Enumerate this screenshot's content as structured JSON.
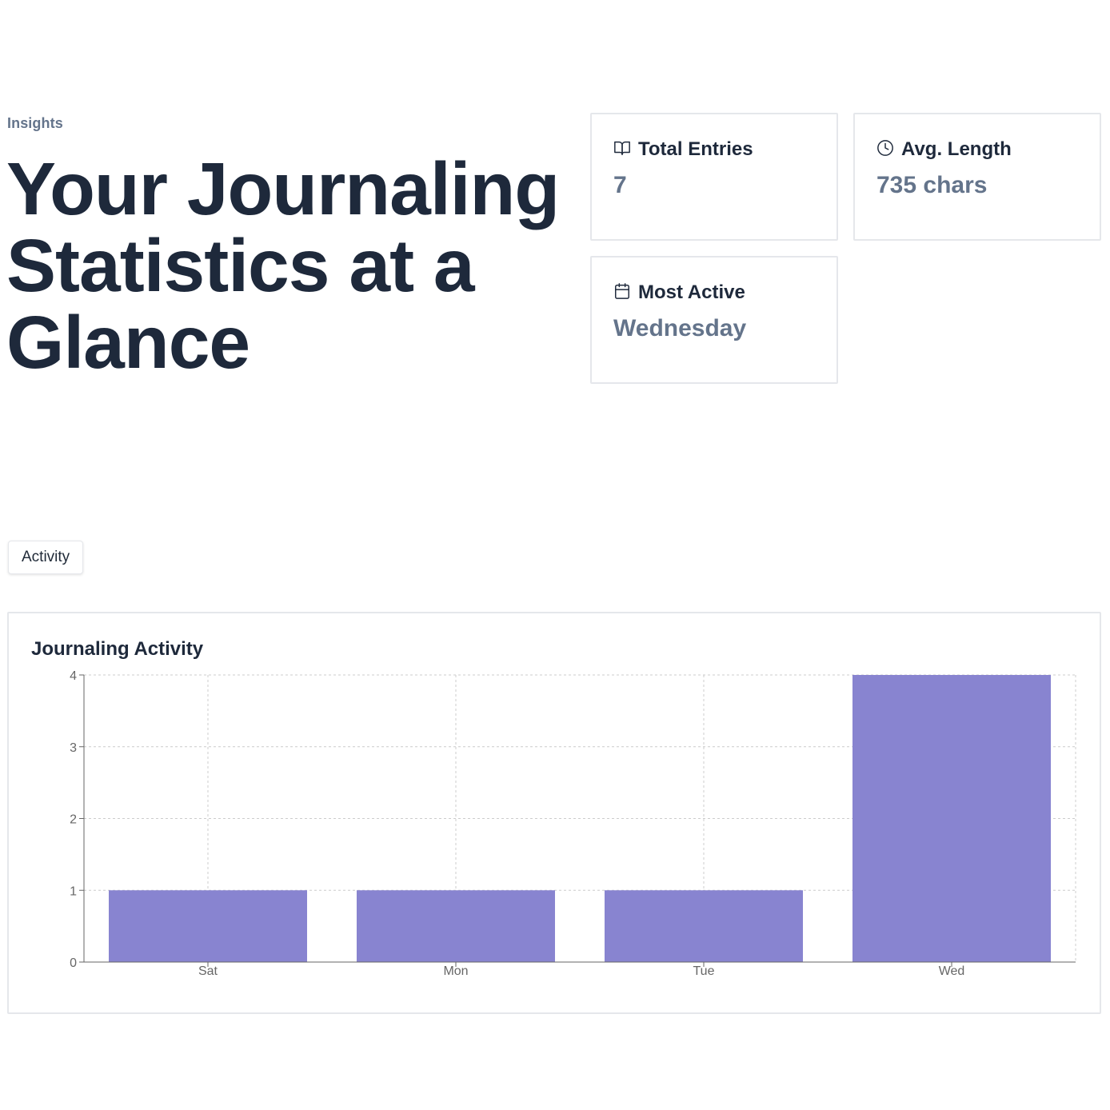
{
  "header": {
    "eyebrow": "Insights",
    "title": "Your Journaling Statistics at a Glance"
  },
  "stats": {
    "total": {
      "label": "Total Entries",
      "value": "7",
      "icon": "book-open-icon"
    },
    "avg": {
      "label": "Avg. Length",
      "value": "735 chars",
      "icon": "clock-icon"
    },
    "active": {
      "label": "Most Active",
      "value": "Wednesday",
      "icon": "calendar-icon"
    }
  },
  "tabs": [
    {
      "label": "Activity",
      "active": true
    }
  ],
  "colors": {
    "bar": "#8884d0",
    "grid": "#cccccc",
    "axis": "#666666"
  },
  "chart_data": {
    "type": "bar",
    "title": "Journaling Activity",
    "categories": [
      "Sat",
      "Mon",
      "Tue",
      "Wed"
    ],
    "values": [
      1,
      1,
      1,
      4
    ],
    "xlabel": "",
    "ylabel": "",
    "ylim": [
      0,
      4
    ],
    "yticks": [
      0,
      1,
      2,
      3,
      4
    ],
    "grid": true,
    "legend": "none"
  }
}
